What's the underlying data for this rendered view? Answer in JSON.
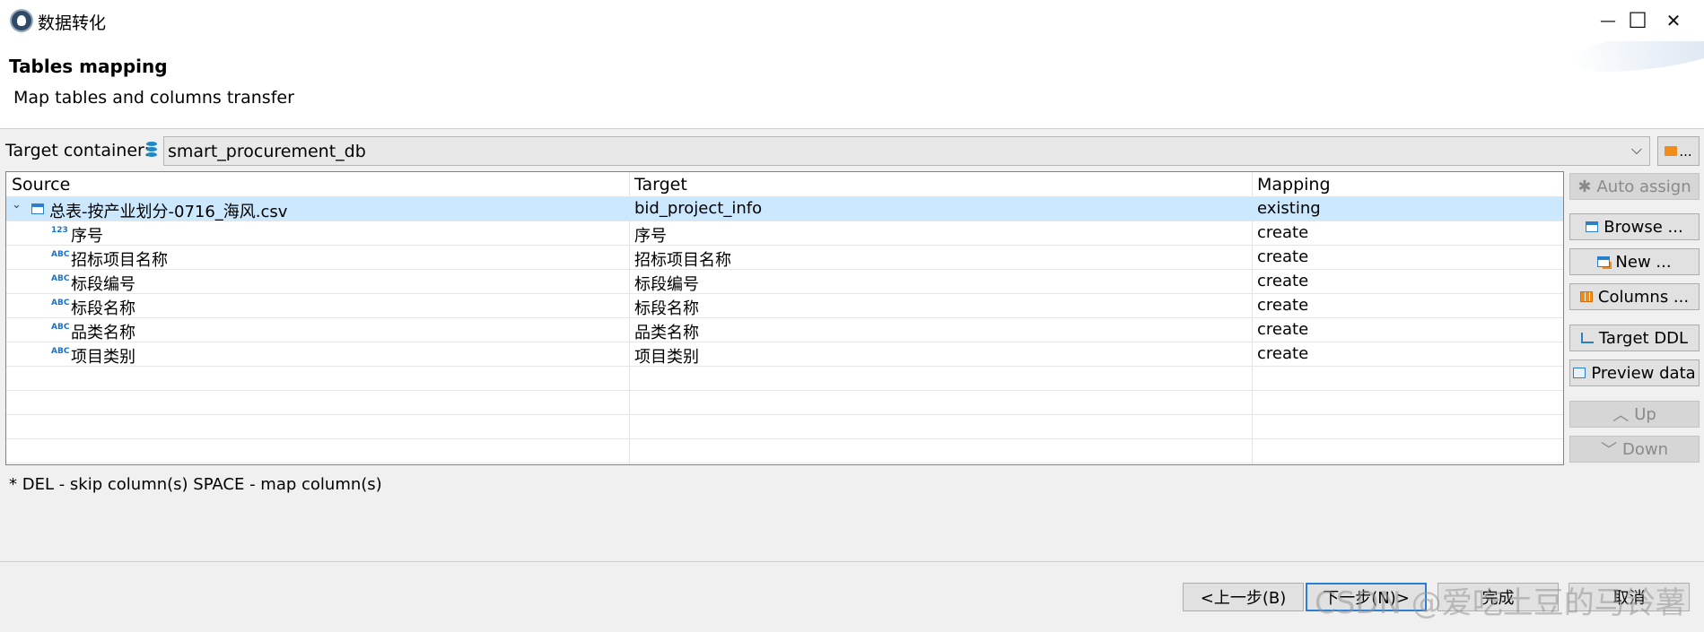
{
  "window": {
    "title": "数据转化",
    "minimize": "—",
    "maximize": "☐",
    "close": "✕"
  },
  "header": {
    "title": "Tables mapping",
    "description": "Map tables and columns transfer"
  },
  "container": {
    "label": "Target container:",
    "value": "smart_procurement_db",
    "arrow": "⌵",
    "browse_label": "..."
  },
  "table": {
    "columns": [
      "Source",
      "Target",
      "Mapping"
    ],
    "rows": [
      {
        "source": "总表-按产业划分-0716_海风.csv",
        "target": "bid_project_info",
        "mapping": "existing",
        "expander": "⌄",
        "type": "table"
      },
      {
        "source": "序号",
        "target": "序号",
        "mapping": "create",
        "type": "123"
      },
      {
        "source": "招标项目名称",
        "target": "招标项目名称",
        "mapping": "create",
        "type": "ABC"
      },
      {
        "source": "标段编号",
        "target": "标段编号",
        "mapping": "create",
        "type": "ABC"
      },
      {
        "source": "标段名称",
        "target": "标段名称",
        "mapping": "create",
        "type": "ABC"
      },
      {
        "source": "品类名称",
        "target": "品类名称",
        "mapping": "create",
        "type": "ABC"
      },
      {
        "source": "项目类别",
        "target": "项目类别",
        "mapping": "create",
        "type": "ABC"
      }
    ]
  },
  "side_buttons": {
    "auto_assign": "Auto assign",
    "browse": "Browse ...",
    "new": "New ...",
    "columns": "Columns ...",
    "target_ddl": "Target DDL",
    "preview_data": "Preview data",
    "up": "Up",
    "down": "Down",
    "auto_assign_icon": "✱",
    "up_icon": "︿",
    "down_icon": "﹀"
  },
  "hint": "* DEL - skip column(s)  SPACE - map column(s)",
  "footer": {
    "back": "<上一步(B)",
    "next": "下一步(N)>",
    "finish": "完成",
    "cancel": "取消"
  },
  "watermark": "CSDN @爱吃土豆的马铃薯",
  "colors": {
    "selection": "#cce8ff",
    "accent": "#2a7fd4",
    "type_icon": "#1a73c9",
    "folder": "#f08c1a"
  }
}
